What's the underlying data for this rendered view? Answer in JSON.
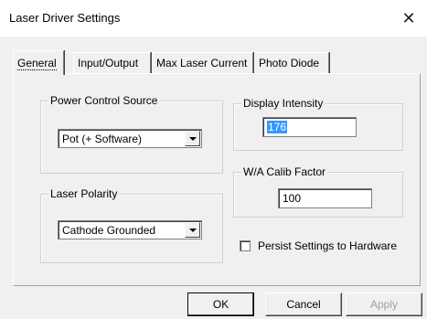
{
  "window": {
    "title": "Laser Driver Settings",
    "close_glyph": "✕"
  },
  "tabs": [
    {
      "label": "General",
      "active": true
    },
    {
      "label": "Input/Output",
      "active": false
    },
    {
      "label": "Max Laser Current",
      "active": false
    },
    {
      "label": "Photo Diode",
      "active": false
    }
  ],
  "general": {
    "power_control_source": {
      "label": "Power Control Source",
      "selected": "Pot (+ Software)"
    },
    "laser_polarity": {
      "label": "Laser Polarity",
      "selected": "Cathode Grounded"
    },
    "display_intensity": {
      "label": "Display Intensity",
      "value": "176"
    },
    "wa_calib_factor": {
      "label": "W/A Calib Factor",
      "value": "100"
    },
    "persist_settings": {
      "label": "Persist Settings to Hardware",
      "checked": false
    }
  },
  "buttons": {
    "ok": "OK",
    "cancel": "Cancel",
    "apply": "Apply"
  },
  "icons": {
    "close": "close-icon",
    "dropdown": "chevron-down-icon"
  }
}
